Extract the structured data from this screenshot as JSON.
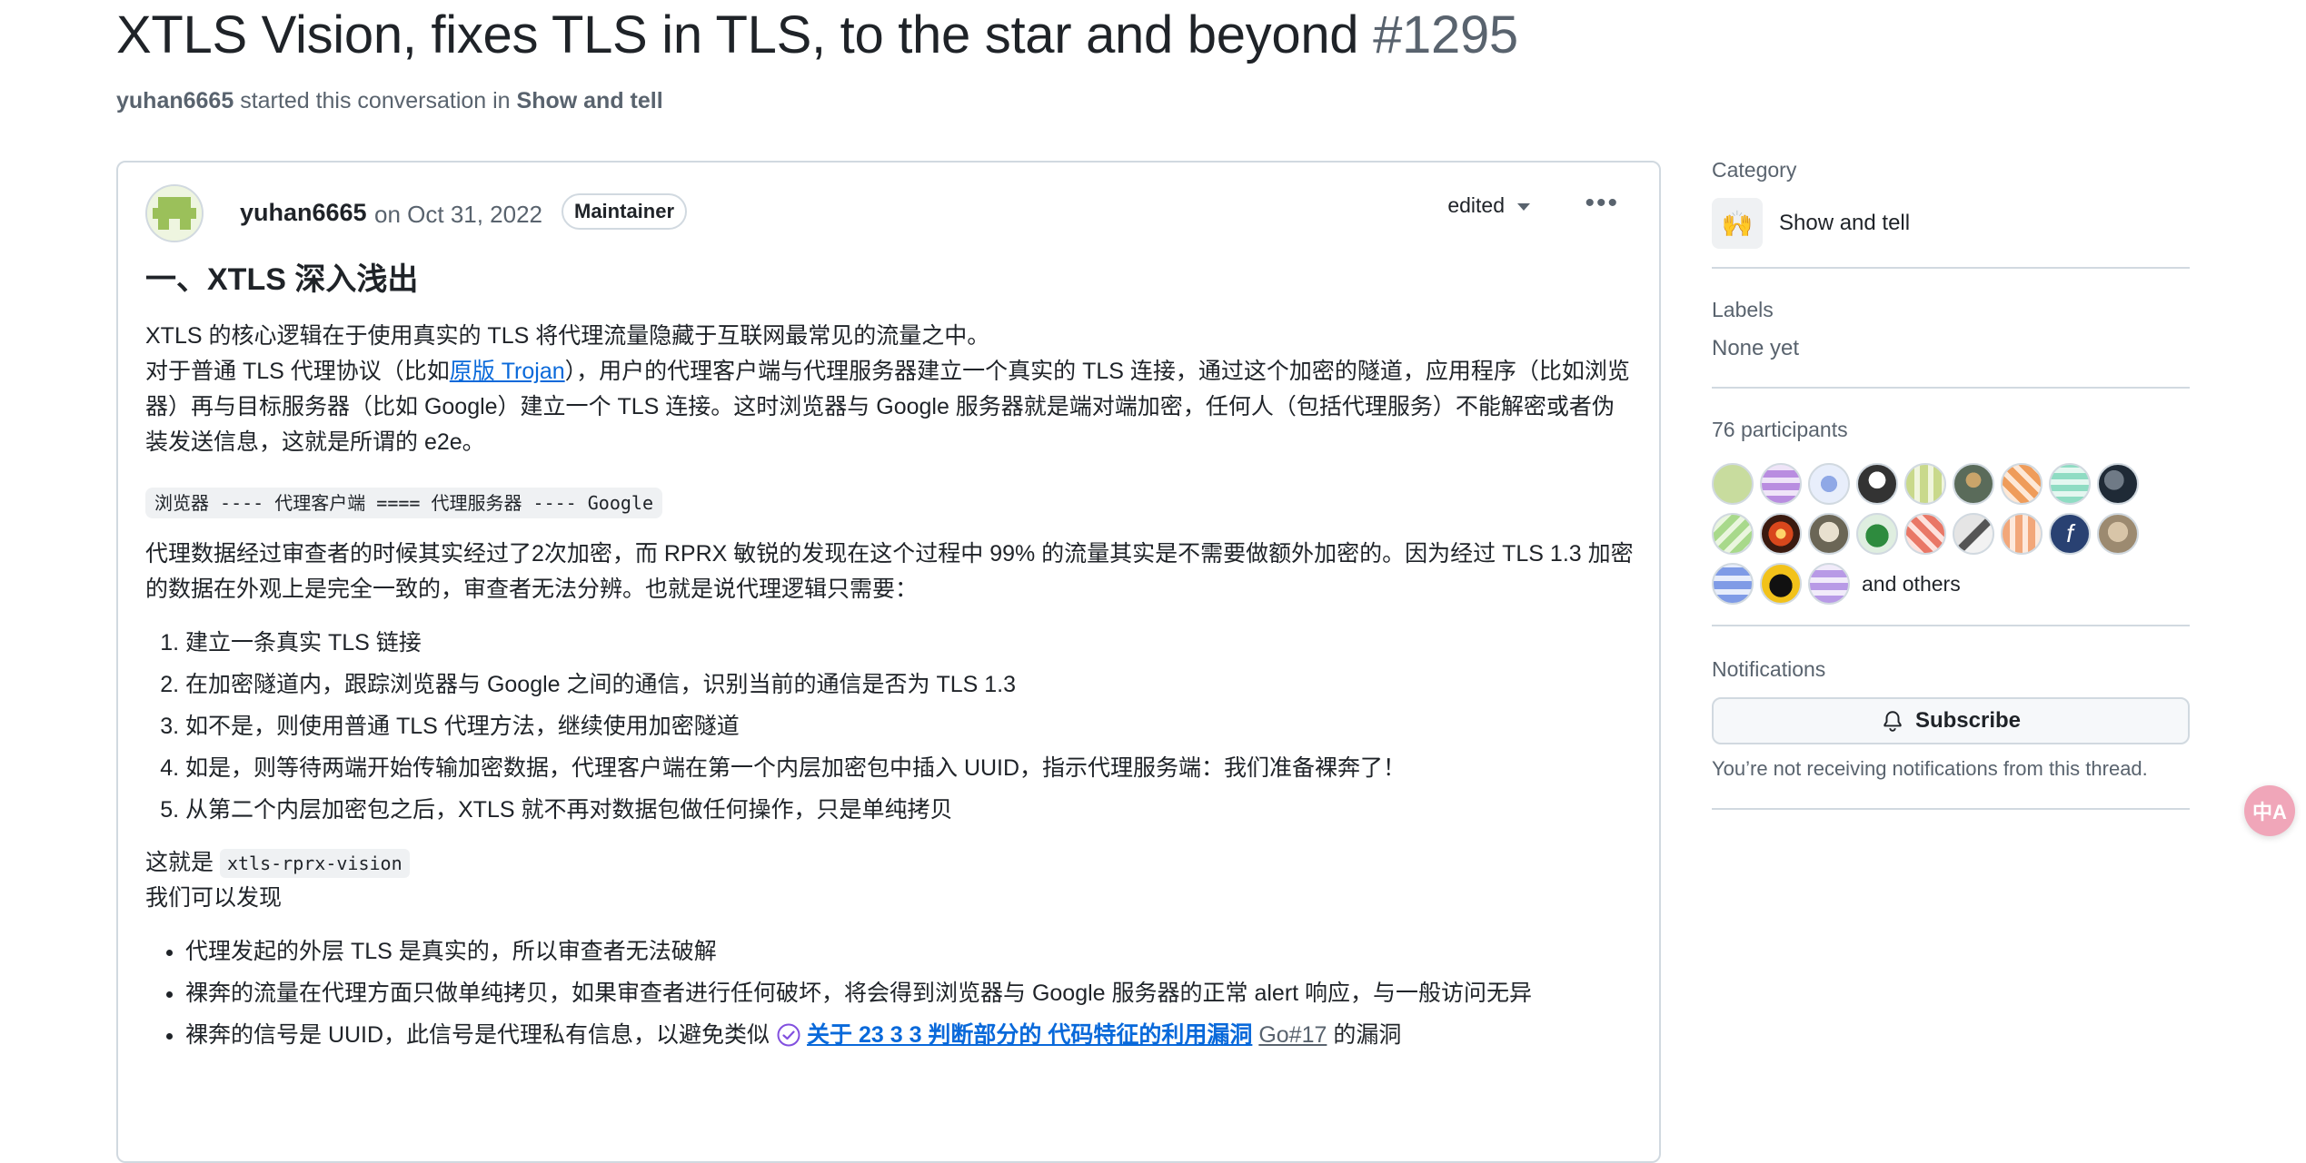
{
  "header": {
    "title": "XTLS Vision, fixes TLS in TLS, to the star and beyond",
    "number": "#1295",
    "author": "yuhan6665",
    "started_text": "started this conversation in",
    "category_link": "Show and tell"
  },
  "post": {
    "author": "yuhan6665",
    "date": "on Oct 31, 2022",
    "badge": "Maintainer",
    "edited": "edited",
    "heading": "一、XTLS 深入浅出",
    "p1": "XTLS 的核心逻辑在于使用真实的 TLS 将代理流量隐藏于互联网最常见的流量之中。",
    "p2_before": "对于普通 TLS 代理协议（比如",
    "p2_link": "原版 Trojan",
    "p2_after": "），用户的代理客户端与代理服务器建立一个真实的 TLS 连接，通过这个加密的隧道，应用程序（比如浏览器）再与目标服务器（比如 Google）建立一个 TLS 连接。这时浏览器与 Google 服务器就是端对端加密，任何人（包括代理服务）不能解密或者伪装发送信息，这就是所谓的 e2e。",
    "code": "浏览器 ---- 代理客户端 ==== 代理服务器 ---- Google",
    "p3": "代理数据经过审查者的时候其实经过了2次加密，而 RPRX 敏锐的发现在这个过程中 99% 的流量其实是不需要做额外加密的。因为经过 TLS 1.3 加密的数据在外观上是完全一致的，审查者无法分辨。也就是说代理逻辑只需要：",
    "steps": [
      "建立一条真实 TLS 链接",
      "在加密隧道内，跟踪浏览器与 Google 之间的通信，识别当前的通信是否为 TLS 1.3",
      "如不是，则使用普通 TLS 代理方法，继续使用加密隧道",
      "如是，则等待两端开始传输加密数据，代理客户端在第一个内层加密包中插入 UUID，指示代理服务端：我们准备裸奔了！",
      "从第二个内层加密包之后，XTLS 就不再对数据包做任何操作，只是单纯拷贝"
    ],
    "p4_before": "这就是",
    "p4_code": "xtls-rprx-vision",
    "p5": "我们可以发现",
    "bullets": [
      "代理发起的外层 TLS 是真实的，所以审查者无法破解",
      "裸奔的流量在代理方面只做单纯拷贝，如果审查者进行任何破坏，将会得到浏览器与 Google 服务器的正常 alert 响应，与一般访问无异"
    ],
    "bullet3_before": "裸奔的信号是 UUID，此信号是代理私有信息，以避免类似",
    "bullet3_link": "关于 23 3 3 判断部分的 代码特征的利用漏洞",
    "bullet3_ref": "Go#17",
    "bullet3_after": "的漏洞"
  },
  "sidebar": {
    "category_title": "Category",
    "category_name": "Show and tell",
    "labels_title": "Labels",
    "labels_value": "None yet",
    "participants_title": "76 participants",
    "and_others": "and others",
    "notifications_title": "Notifications",
    "subscribe_label": "Subscribe",
    "notify_note": "You’re not receiving notifications from this thread."
  },
  "colors": {
    "link": "#0969da",
    "muted": "#59636e",
    "border": "#d1d9e0"
  },
  "translate_icon": "中A"
}
